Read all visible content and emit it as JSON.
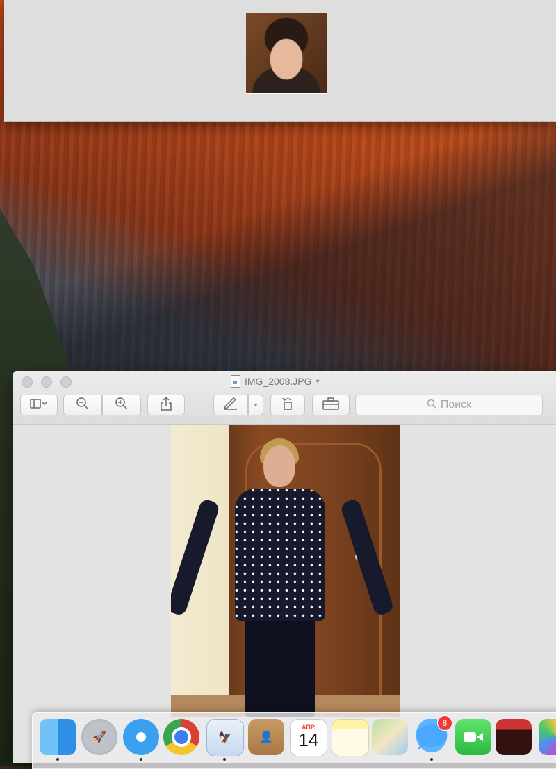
{
  "preview": {
    "title": "IMG_2008.JPG",
    "search_placeholder": "Поиск"
  },
  "dock": {
    "calendar_month": "АПР.",
    "calendar_day": "14",
    "messages_badge": "8"
  },
  "icons": {
    "sidebar": "sidebar-icon",
    "zoom_out": "zoom-out-icon",
    "zoom_in": "zoom-in-icon",
    "share": "share-icon",
    "markup": "markup-pen-icon",
    "rotate": "rotate-icon",
    "toolbox": "toolbox-icon",
    "search": "search-icon"
  }
}
